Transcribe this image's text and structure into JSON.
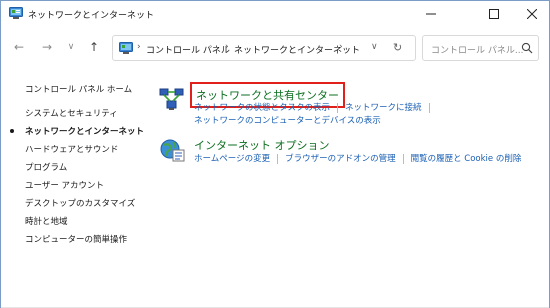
{
  "window": {
    "title": "ネットワークとインターネット",
    "controls": {
      "minimize": "—",
      "maximize": "□",
      "close": "✕"
    }
  },
  "nav": {
    "back_glyph": "←",
    "forward_glyph": "→",
    "recent_glyph": "∨",
    "up_glyph": "↑"
  },
  "address": {
    "crumbs": [
      "コントロール パネル",
      "ネットワークとインターネット"
    ],
    "separator": "›",
    "dropdown_glyph": "∨",
    "refresh_glyph": "↻"
  },
  "search": {
    "placeholder": "コントロール パネル..."
  },
  "sidebar": {
    "home": "コントロール パネル ホーム",
    "items": [
      {
        "label": "システムとセキュリティ",
        "active": false
      },
      {
        "label": "ネットワークとインターネット",
        "active": true
      },
      {
        "label": "ハードウェアとサウンド",
        "active": false
      },
      {
        "label": "プログラム",
        "active": false
      },
      {
        "label": "ユーザー アカウント",
        "active": false
      },
      {
        "label": "デスクトップのカスタマイズ",
        "active": false
      },
      {
        "label": "時計と地域",
        "active": false
      },
      {
        "label": "コンピューターの簡単操作",
        "active": false
      }
    ]
  },
  "categories": [
    {
      "title": "ネットワークと共有センター",
      "highlighted": true,
      "icon": "network-center-icon",
      "tasks_line1": [
        "ネットワークの状態とタスクの表示",
        "ネットワークに接続"
      ],
      "tasks_line2": [
        "ネットワークのコンピューターとデバイスの表示"
      ]
    },
    {
      "title": "インターネット オプション",
      "highlighted": false,
      "icon": "internet-options-icon",
      "tasks_line1": [
        "ホームページの変更",
        "ブラウザーのアドオンの管理",
        "閲覧の履歴と Cookie の削除"
      ],
      "tasks_line2": []
    }
  ],
  "colors": {
    "link": "#1a5fb4",
    "category_title": "#0b6e1f",
    "highlight_box": "#e0201a"
  }
}
